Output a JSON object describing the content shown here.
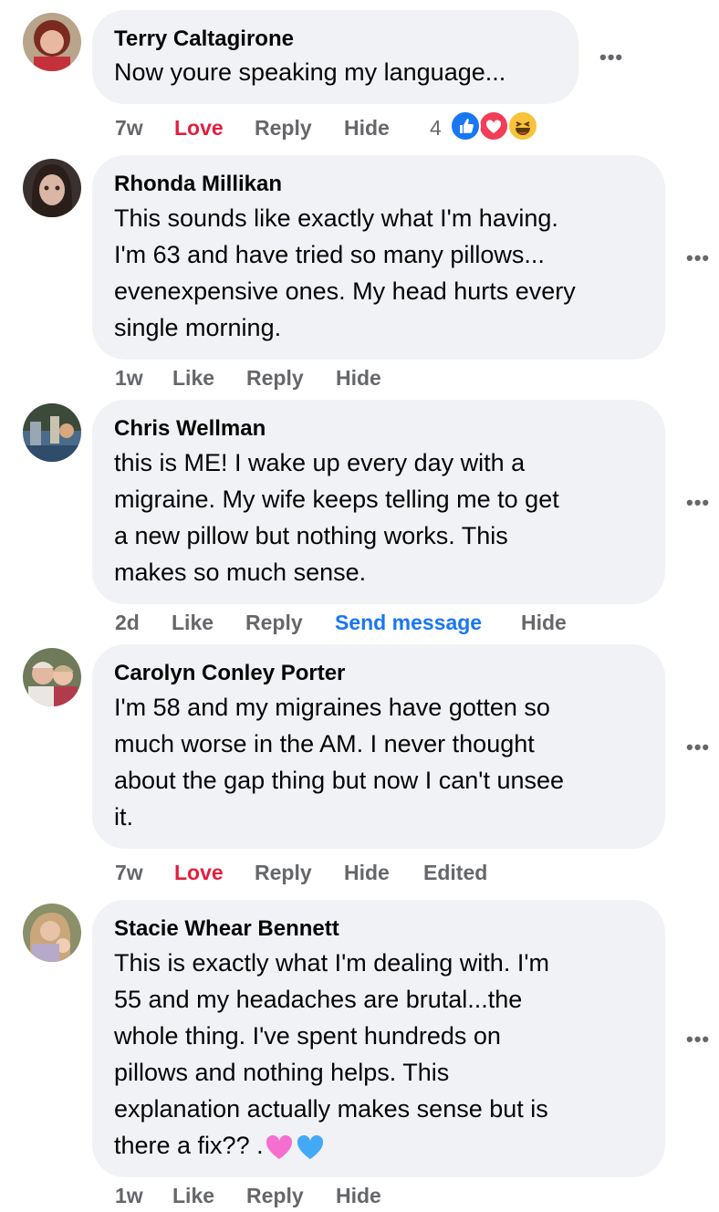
{
  "comments": [
    {
      "author": "Terry Caltagirone",
      "text": "Now youre speaking my language...",
      "time": "7w",
      "reaction_action": "Love",
      "reply": "Reply",
      "hide": "Hide",
      "reaction_count": "4"
    },
    {
      "author": "Rhonda Millikan",
      "text": "This sounds like exactly what I'm having.\nI'm 63 and have tried so many pillows...\nevenexpensive ones. My head hurts every\nsingle morning.",
      "time": "1w",
      "reaction_action": "Like",
      "reply": "Reply",
      "hide": "Hide"
    },
    {
      "author": "Chris Wellman",
      "text": "this is ME! I wake up every day with a\nmigraine. My wife keeps telling me to get\na new pillow but nothing works. This\nmakes so much sense.",
      "time": "2d",
      "reaction_action": "Like",
      "reply": "Reply",
      "send_message": "Send message",
      "hide": "Hide"
    },
    {
      "author": "Carolyn Conley Porter",
      "text": "I'm 58 and my migraines have gotten so\nmuch worse in the AM. I never thought\nabout the gap thing but now I can't unsee\nit.",
      "time": "7w",
      "reaction_action": "Love",
      "reply": "Reply",
      "hide": "Hide",
      "edited": "Edited"
    },
    {
      "author": "Stacie Whear Bennett",
      "text": "This is exactly what I'm dealing with. I'm\n55 and my headaches are brutal...the\nwhole thing. I've spent hundreds on\npillows and nothing helps. This\nexplanation actually makes sense but is\nthere a fix?? .",
      "time": "1w",
      "reaction_action": "Like",
      "reply": "Reply",
      "hide": "Hide"
    }
  ],
  "more_label": "•••",
  "colors": {
    "bubble": "#f0f2f5",
    "meta": "#65676b",
    "love": "#e41e3f",
    "link": "#1877f2"
  }
}
